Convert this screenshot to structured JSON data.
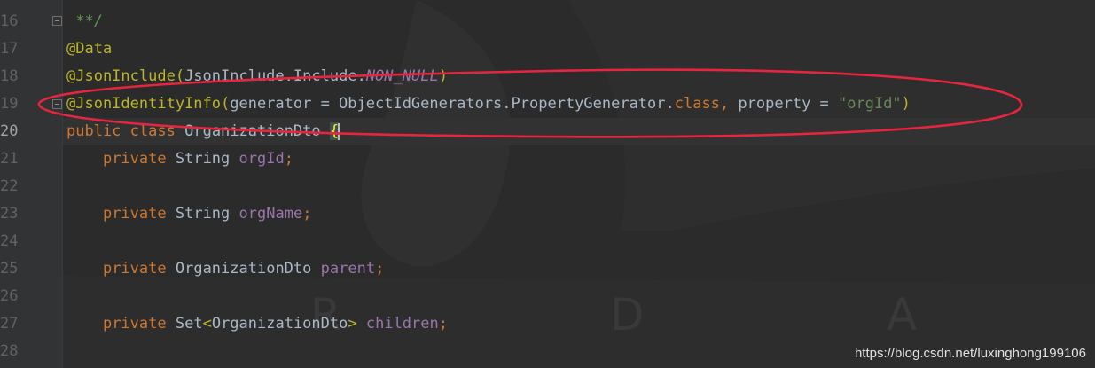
{
  "colors": {
    "background": "#2b2b2b",
    "keyword": "#cc7832",
    "annotation": "#bbb529",
    "field": "#9876aa",
    "string": "#6a8759",
    "highlight_oval": "#e8253f"
  },
  "gutter": {
    "line_numbers": [
      "16",
      "17",
      "18",
      "19",
      "20",
      "21",
      "22",
      "23",
      "24",
      "25",
      "26",
      "27",
      "28"
    ],
    "current_line": "20"
  },
  "code": {
    "partial_top": "* ......",
    "doc_end": " **/",
    "l17": {
      "annotation": "@Data"
    },
    "l18": {
      "annotation": "@JsonInclude(",
      "class_ref": "JsonInclude",
      "dot1": ".",
      "include": "Include",
      "dot2": ".",
      "const": "NON_NULL",
      "close": ")"
    },
    "l19": {
      "annotation": "@JsonIdentityInfo(",
      "arg1": "generator = ObjectIdGenerators.PropertyGenerator.",
      "kw_class": "class",
      "comma": ",",
      "arg2": " property = ",
      "str": "\"orgId\"",
      "close": ")"
    },
    "l20": {
      "kw_public": "public",
      "kw_class": "class",
      "name": "OrganizationDto",
      "brace": "{"
    },
    "l21": {
      "kw": "private",
      "type": "String",
      "field": "orgId",
      "semi": ";"
    },
    "l23": {
      "kw": "private",
      "type": "String",
      "field": "orgName",
      "semi": ";"
    },
    "l25": {
      "kw": "private",
      "type": "OrganizationDto",
      "field": "parent",
      "semi": ";"
    },
    "l27": {
      "kw": "private",
      "type_start": "Set",
      "lt": "<",
      "type_arg": "OrganizationDto",
      "gt": ">",
      "field": "children",
      "semi": ";"
    }
  },
  "watermark": {
    "url": "https://blog.csdn.net/luxinghong199106",
    "letters": [
      "R",
      "D",
      "A"
    ]
  }
}
